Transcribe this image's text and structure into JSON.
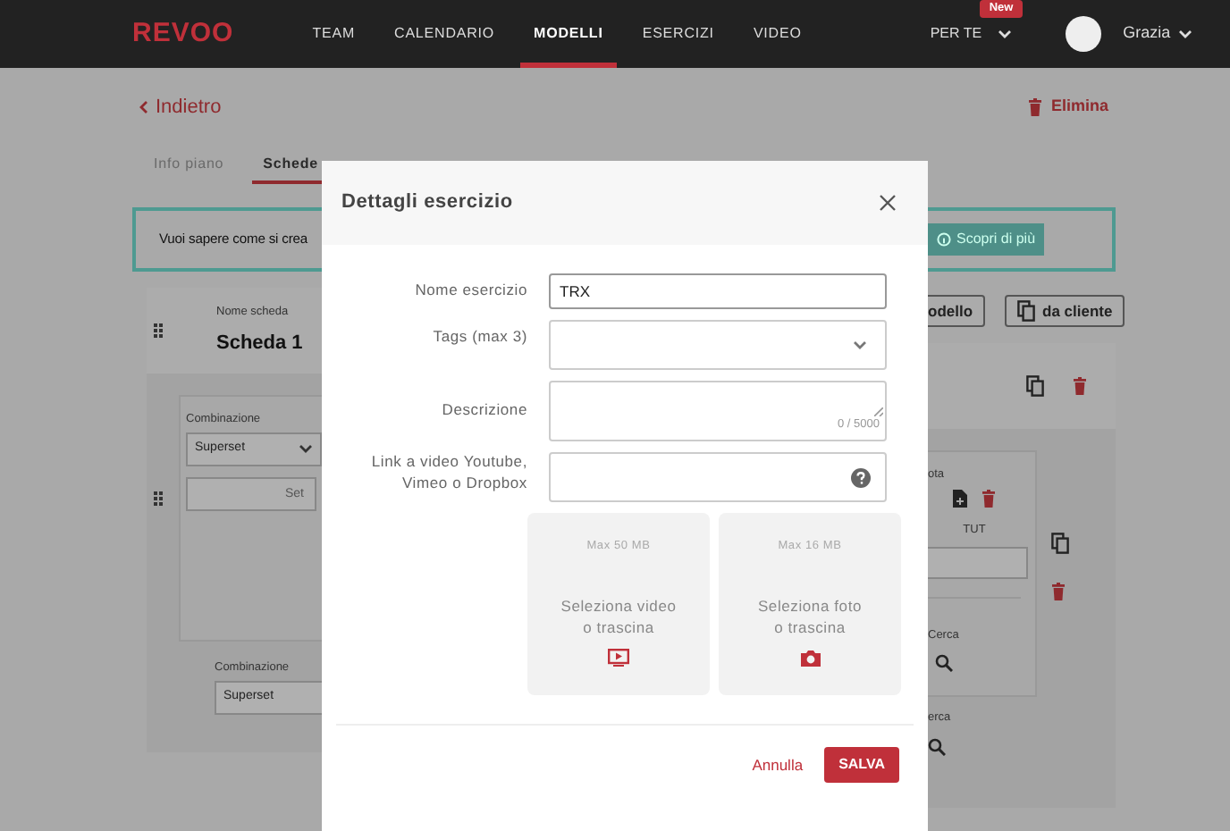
{
  "navbar": {
    "logo": "REVOO",
    "items": [
      {
        "label": "TEAM",
        "selected": false
      },
      {
        "label": "CALENDARIO",
        "selected": false
      },
      {
        "label": "MODELLI",
        "selected": true
      },
      {
        "label": "ESERCIZI",
        "selected": false
      },
      {
        "label": "VIDEO",
        "selected": false
      }
    ],
    "menu": {
      "label": "PER TE",
      "badge": "New"
    },
    "user": {
      "name": "Grazia"
    }
  },
  "page": {
    "back": "Indietro",
    "delete": "Elimina",
    "tabs": [
      {
        "label": "Info piano",
        "selected": false
      },
      {
        "label": "Schede",
        "selected": true
      }
    ],
    "banner": {
      "text": "Vuoi sapere come si crea",
      "button": "Scopri di più"
    },
    "actions": [
      "odello",
      "da cliente"
    ],
    "card": {
      "name_label": "Nome scheda",
      "name": "Scheda 1",
      "group": {
        "combination_label": "Combinazione",
        "combination": "Superset",
        "set_placeholder": "Set",
        "note_label": "ota",
        "tut_label": "TUT",
        "search_label": "Cerca"
      },
      "next_group": {
        "combination_label": "Combinazione",
        "combination": "Superset",
        "search_label": "erca"
      }
    }
  },
  "modal": {
    "title": "Dettagli esercizio",
    "fields": [
      {
        "kind": "text",
        "label": "Nome esercizio",
        "value": "TRX"
      },
      {
        "kind": "select",
        "label": "Tags (max 3)"
      },
      {
        "kind": "textarea",
        "label": "Descrizione",
        "counter": "0 / 5000"
      },
      {
        "kind": "link",
        "label": "Link a video Youtube,\nVimeo o Dropbox"
      }
    ],
    "uploads": [
      {
        "kind": "video",
        "limit": "Max 50 MB",
        "text": "Seleziona video\no trascina"
      },
      {
        "kind": "photo",
        "limit": "Max 16 MB",
        "text": "Seleziona foto\no trascina"
      }
    ],
    "cancel": "Annulla",
    "save": "SALVA"
  }
}
